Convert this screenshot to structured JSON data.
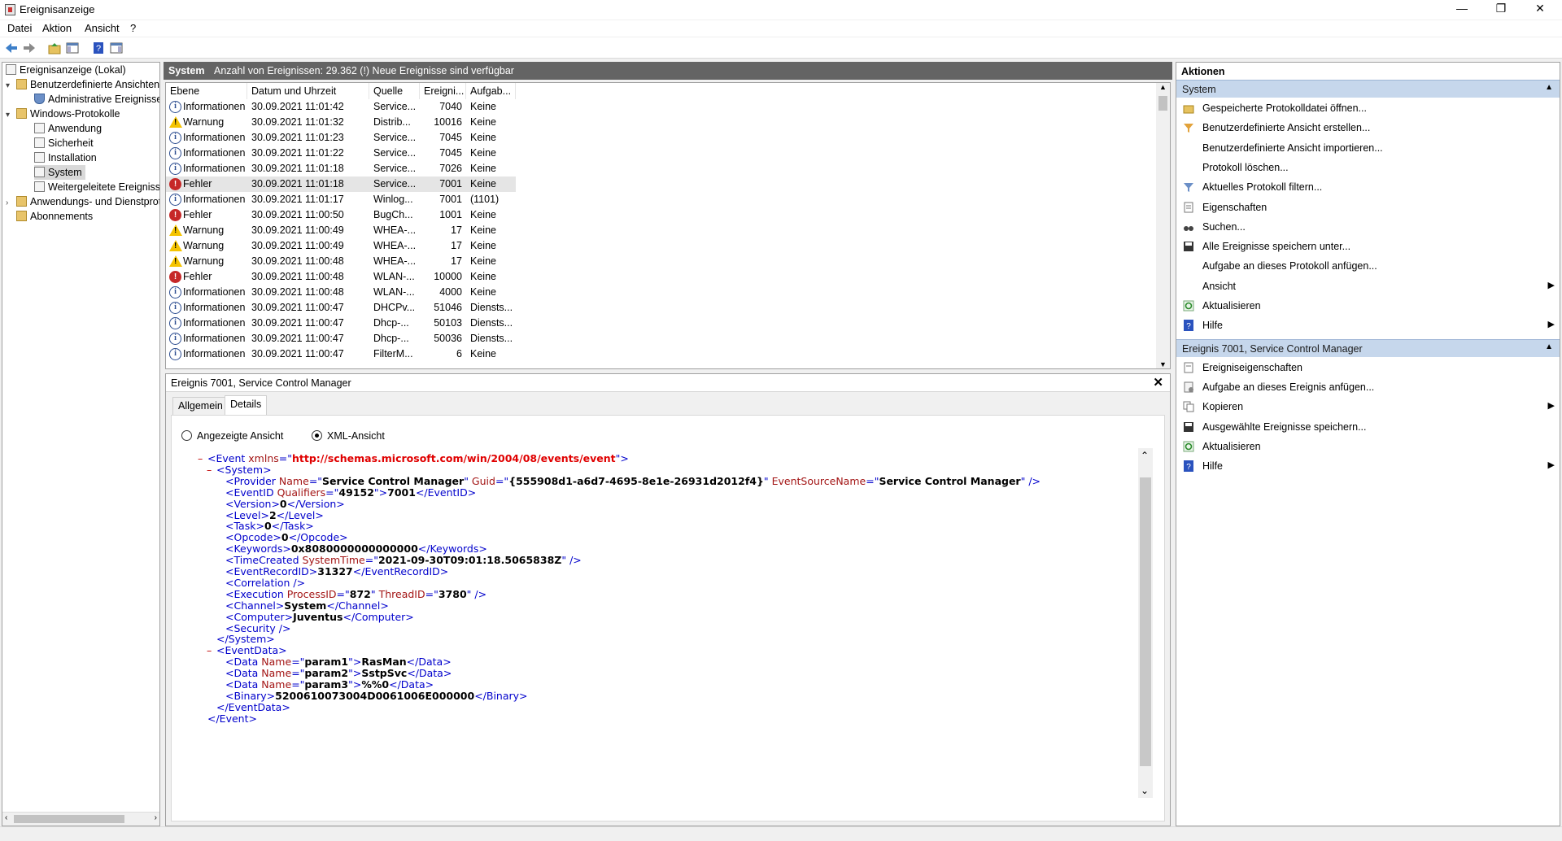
{
  "window": {
    "title": "Ereignisanzeige",
    "controls": {
      "minimize": "—",
      "maximize": "❐",
      "close": "✕"
    }
  },
  "menu": [
    "Datei",
    "Aktion",
    "Ansicht",
    "?"
  ],
  "toolbar": {
    "icons": [
      "back-arrow-icon",
      "forward-arrow-icon",
      "folder-up-icon",
      "show-hide-tree-icon",
      "help-icon",
      "show-hide-action-pane-icon"
    ]
  },
  "tree": {
    "items": [
      {
        "label": "Ereignisanzeige (Lokal)",
        "icon": "event-viewer-icon",
        "level": 0,
        "expander": ""
      },
      {
        "label": "Benutzerdefinierte Ansichten",
        "icon": "folder-icon",
        "level": 1,
        "expander": "▾"
      },
      {
        "label": "Administrative Ereignisse",
        "icon": "filter-icon",
        "level": 2,
        "expander": ""
      },
      {
        "label": "Windows-Protokolle",
        "icon": "folder-icon",
        "level": 1,
        "expander": "▾"
      },
      {
        "label": "Anwendung",
        "icon": "log-icon",
        "level": 2,
        "expander": ""
      },
      {
        "label": "Sicherheit",
        "icon": "log-icon",
        "level": 2,
        "expander": ""
      },
      {
        "label": "Installation",
        "icon": "log-icon",
        "level": 2,
        "expander": ""
      },
      {
        "label": "System",
        "icon": "log-icon",
        "level": 2,
        "expander": "",
        "selected": true
      },
      {
        "label": "Weitergeleitete Ereignisse",
        "icon": "log-icon",
        "level": 2,
        "expander": ""
      },
      {
        "label": "Anwendungs- und Dienstprotokolle",
        "icon": "folder-icon",
        "level": 1,
        "expander": "›"
      },
      {
        "label": "Abonnements",
        "icon": "subscriptions-icon",
        "level": 1,
        "expander": ""
      }
    ]
  },
  "header": {
    "log_name": "System",
    "info": "Anzahl von Ereignissen: 29.362 (!) Neue Ereignisse sind verfügbar"
  },
  "events": {
    "columns": [
      "Ebene",
      "Datum und Uhrzeit",
      "Quelle",
      "Ereigni...",
      "Aufgab..."
    ],
    "rows": [
      {
        "level": "Informationen",
        "type": "info",
        "date": "30.09.2021 11:01:42",
        "source": "Service...",
        "id": "7040",
        "task": "Keine"
      },
      {
        "level": "Warnung",
        "type": "warn",
        "date": "30.09.2021 11:01:32",
        "source": "Distrib...",
        "id": "10016",
        "task": "Keine"
      },
      {
        "level": "Informationen",
        "type": "info",
        "date": "30.09.2021 11:01:23",
        "source": "Service...",
        "id": "7045",
        "task": "Keine"
      },
      {
        "level": "Informationen",
        "type": "info",
        "date": "30.09.2021 11:01:22",
        "source": "Service...",
        "id": "7045",
        "task": "Keine"
      },
      {
        "level": "Informationen",
        "type": "info",
        "date": "30.09.2021 11:01:18",
        "source": "Service...",
        "id": "7026",
        "task": "Keine"
      },
      {
        "level": "Fehler",
        "type": "err",
        "date": "30.09.2021 11:01:18",
        "source": "Service...",
        "id": "7001",
        "task": "Keine",
        "selected": true
      },
      {
        "level": "Informationen",
        "type": "info",
        "date": "30.09.2021 11:01:17",
        "source": "Winlog...",
        "id": "7001",
        "task": "(1101)"
      },
      {
        "level": "Fehler",
        "type": "err",
        "date": "30.09.2021 11:00:50",
        "source": "BugCh...",
        "id": "1001",
        "task": "Keine"
      },
      {
        "level": "Warnung",
        "type": "warn",
        "date": "30.09.2021 11:00:49",
        "source": "WHEA-...",
        "id": "17",
        "task": "Keine"
      },
      {
        "level": "Warnung",
        "type": "warn",
        "date": "30.09.2021 11:00:49",
        "source": "WHEA-...",
        "id": "17",
        "task": "Keine"
      },
      {
        "level": "Warnung",
        "type": "warn",
        "date": "30.09.2021 11:00:48",
        "source": "WHEA-...",
        "id": "17",
        "task": "Keine"
      },
      {
        "level": "Fehler",
        "type": "err",
        "date": "30.09.2021 11:00:48",
        "source": "WLAN-...",
        "id": "10000",
        "task": "Keine"
      },
      {
        "level": "Informationen",
        "type": "info",
        "date": "30.09.2021 11:00:48",
        "source": "WLAN-...",
        "id": "4000",
        "task": "Keine"
      },
      {
        "level": "Informationen",
        "type": "info",
        "date": "30.09.2021 11:00:47",
        "source": "DHCPv...",
        "id": "51046",
        "task": "Diensts..."
      },
      {
        "level": "Informationen",
        "type": "info",
        "date": "30.09.2021 11:00:47",
        "source": "Dhcp-...",
        "id": "50103",
        "task": "Diensts..."
      },
      {
        "level": "Informationen",
        "type": "info",
        "date": "30.09.2021 11:00:47",
        "source": "Dhcp-...",
        "id": "50036",
        "task": "Diensts..."
      },
      {
        "level": "Informationen",
        "type": "info",
        "date": "30.09.2021 11:00:47",
        "source": "FilterM...",
        "id": "6",
        "task": "Keine"
      }
    ]
  },
  "detail": {
    "title": "Ereignis 7001, Service Control Manager",
    "tabs": [
      "Allgemein",
      "Details"
    ],
    "active_tab": "Details",
    "view_options": [
      "Angezeigte Ansicht",
      "XML-Ansicht"
    ],
    "selected_view": "XML-Ansicht",
    "xml_lines": [
      {
        "indent": 0,
        "minus": true,
        "parts": [
          [
            "tag",
            "<Event "
          ],
          [
            "attr",
            "xmlns"
          ],
          [
            "tag",
            "=\""
          ],
          [
            "url",
            "http://schemas.microsoft.com/win/2004/08/events/event"
          ],
          [
            "tag",
            "\">"
          ]
        ]
      },
      {
        "indent": 1,
        "minus": true,
        "parts": [
          [
            "tag",
            "<System>"
          ]
        ]
      },
      {
        "indent": 2,
        "parts": [
          [
            "tag",
            "<Provider "
          ],
          [
            "attr",
            "Name"
          ],
          [
            "tag",
            "=\""
          ],
          [
            "val",
            "Service Control Manager"
          ],
          [
            "tag",
            "\" "
          ],
          [
            "attr",
            "Guid"
          ],
          [
            "tag",
            "=\""
          ],
          [
            "val",
            "{555908d1-a6d7-4695-8e1e-26931d2012f4}"
          ],
          [
            "tag",
            "\" "
          ],
          [
            "attr",
            "EventSourceName"
          ],
          [
            "tag",
            "=\""
          ],
          [
            "val",
            "Service Control Manager"
          ],
          [
            "tag",
            "\" />"
          ]
        ]
      },
      {
        "indent": 2,
        "parts": [
          [
            "tag",
            "<EventID "
          ],
          [
            "attr",
            "Qualifiers"
          ],
          [
            "tag",
            "=\""
          ],
          [
            "val",
            "49152"
          ],
          [
            "tag",
            "\">"
          ],
          [
            "val",
            "7001"
          ],
          [
            "tag",
            "</EventID>"
          ]
        ]
      },
      {
        "indent": 2,
        "parts": [
          [
            "tag",
            "<Version>"
          ],
          [
            "val",
            "0"
          ],
          [
            "tag",
            "</Version>"
          ]
        ]
      },
      {
        "indent": 2,
        "parts": [
          [
            "tag",
            "<Level>"
          ],
          [
            "val",
            "2"
          ],
          [
            "tag",
            "</Level>"
          ]
        ]
      },
      {
        "indent": 2,
        "parts": [
          [
            "tag",
            "<Task>"
          ],
          [
            "val",
            "0"
          ],
          [
            "tag",
            "</Task>"
          ]
        ]
      },
      {
        "indent": 2,
        "parts": [
          [
            "tag",
            "<Opcode>"
          ],
          [
            "val",
            "0"
          ],
          [
            "tag",
            "</Opcode>"
          ]
        ]
      },
      {
        "indent": 2,
        "parts": [
          [
            "tag",
            "<Keywords>"
          ],
          [
            "val",
            "0x8080000000000000"
          ],
          [
            "tag",
            "</Keywords>"
          ]
        ]
      },
      {
        "indent": 2,
        "parts": [
          [
            "tag",
            "<TimeCreated "
          ],
          [
            "attr",
            "SystemTime"
          ],
          [
            "tag",
            "=\""
          ],
          [
            "val",
            "2021-09-30T09:01:18.5065838Z"
          ],
          [
            "tag",
            "\" />"
          ]
        ]
      },
      {
        "indent": 2,
        "parts": [
          [
            "tag",
            "<EventRecordID>"
          ],
          [
            "val",
            "31327"
          ],
          [
            "tag",
            "</EventRecordID>"
          ]
        ]
      },
      {
        "indent": 2,
        "parts": [
          [
            "tag",
            "<Correlation />"
          ]
        ]
      },
      {
        "indent": 2,
        "parts": [
          [
            "tag",
            "<Execution "
          ],
          [
            "attr",
            "ProcessID"
          ],
          [
            "tag",
            "=\""
          ],
          [
            "val",
            "872"
          ],
          [
            "tag",
            "\" "
          ],
          [
            "attr",
            "ThreadID"
          ],
          [
            "tag",
            "=\""
          ],
          [
            "val",
            "3780"
          ],
          [
            "tag",
            "\" />"
          ]
        ]
      },
      {
        "indent": 2,
        "parts": [
          [
            "tag",
            "<Channel>"
          ],
          [
            "val",
            "System"
          ],
          [
            "tag",
            "</Channel>"
          ]
        ]
      },
      {
        "indent": 2,
        "parts": [
          [
            "tag",
            "<Computer>"
          ],
          [
            "val",
            "Juventus"
          ],
          [
            "tag",
            "</Computer>"
          ]
        ]
      },
      {
        "indent": 2,
        "parts": [
          [
            "tag",
            "<Security />"
          ]
        ]
      },
      {
        "indent": 1,
        "parts": [
          [
            "tag",
            "</System>"
          ]
        ]
      },
      {
        "indent": 1,
        "minus": true,
        "parts": [
          [
            "tag",
            "<EventData>"
          ]
        ]
      },
      {
        "indent": 2,
        "parts": [
          [
            "tag",
            "<Data "
          ],
          [
            "attr",
            "Name"
          ],
          [
            "tag",
            "=\""
          ],
          [
            "val",
            "param1"
          ],
          [
            "tag",
            "\">"
          ],
          [
            "val",
            "RasMan"
          ],
          [
            "tag",
            "</Data>"
          ]
        ]
      },
      {
        "indent": 2,
        "parts": [
          [
            "tag",
            "<Data "
          ],
          [
            "attr",
            "Name"
          ],
          [
            "tag",
            "=\""
          ],
          [
            "val",
            "param2"
          ],
          [
            "tag",
            "\">"
          ],
          [
            "val",
            "SstpSvc"
          ],
          [
            "tag",
            "</Data>"
          ]
        ]
      },
      {
        "indent": 2,
        "parts": [
          [
            "tag",
            "<Data "
          ],
          [
            "attr",
            "Name"
          ],
          [
            "tag",
            "=\""
          ],
          [
            "val",
            "param3"
          ],
          [
            "tag",
            "\">"
          ],
          [
            "val",
            "%%0"
          ],
          [
            "tag",
            "</Data>"
          ]
        ]
      },
      {
        "indent": 2,
        "parts": [
          [
            "tag",
            "<Binary>"
          ],
          [
            "val",
            "5200610073004D0061006E000000"
          ],
          [
            "tag",
            "</Binary>"
          ]
        ]
      },
      {
        "indent": 1,
        "parts": [
          [
            "tag",
            "</EventData>"
          ]
        ]
      },
      {
        "indent": 0,
        "parts": [
          [
            "tag",
            "</Event>"
          ]
        ]
      }
    ]
  },
  "actions": {
    "title": "Aktionen",
    "sections": [
      {
        "title": "System",
        "items": [
          {
            "label": "Gespeicherte Protokolldatei öffnen...",
            "icon": "open-log-icon"
          },
          {
            "label": "Benutzerdefinierte Ansicht erstellen...",
            "icon": "create-view-icon"
          },
          {
            "label": "Benutzerdefinierte Ansicht importieren...",
            "icon": ""
          },
          {
            "label": "Protokoll löschen...",
            "icon": ""
          },
          {
            "label": "Aktuelles Protokoll filtern...",
            "icon": "filter-icon"
          },
          {
            "label": "Eigenschaften",
            "icon": "properties-icon"
          },
          {
            "label": "Suchen...",
            "icon": "find-icon"
          },
          {
            "label": "Alle Ereignisse speichern unter...",
            "icon": "save-icon"
          },
          {
            "label": "Aufgabe an dieses Protokoll anfügen...",
            "icon": ""
          },
          {
            "label": "Ansicht",
            "icon": "",
            "submenu": true
          },
          {
            "label": "Aktualisieren",
            "icon": "refresh-icon"
          },
          {
            "label": "Hilfe",
            "icon": "help-icon",
            "submenu": true
          }
        ]
      },
      {
        "title": "Ereignis 7001, Service Control Manager",
        "items": [
          {
            "label": "Ereigniseigenschaften",
            "icon": "event-properties-icon"
          },
          {
            "label": "Aufgabe an dieses Ereignis anfügen...",
            "icon": "attach-task-icon"
          },
          {
            "label": "Kopieren",
            "icon": "copy-icon",
            "submenu": true
          },
          {
            "label": "Ausgewählte Ereignisse speichern...",
            "icon": "save-icon"
          },
          {
            "label": "Aktualisieren",
            "icon": "refresh-icon"
          },
          {
            "label": "Hilfe",
            "icon": "help-icon",
            "submenu": true
          }
        ]
      }
    ]
  },
  "colors": {
    "header_bar": "#646464",
    "section_bar": "#c6d7ec",
    "xml_tag": "#0000cc",
    "xml_attr": "#a31515",
    "xml_url": "#e00000",
    "error": "#c62828",
    "warning": "#f5c400",
    "info": "#2a4b8f"
  }
}
